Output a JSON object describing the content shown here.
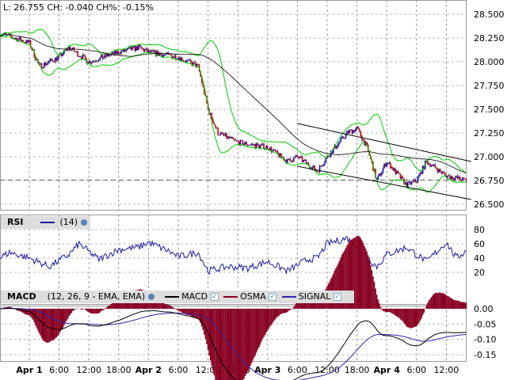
{
  "header": {
    "quote": "L: 26.755 CH: -0.040 CH%: -0.15%"
  },
  "rsi_legend": {
    "title": "RSI",
    "param": "(14)"
  },
  "macd_legend": {
    "title": "MACD",
    "param": "(12, 26, 9 - EMA, EMA)",
    "macd": "MACD",
    "osma": "OSMA",
    "signal": "SIGNAL"
  },
  "colors": {
    "up": "#0000cc",
    "down": "#cc0000",
    "bands": "#00cc00",
    "ma": "#000000",
    "rsi": "#1a1aa0",
    "osma": "#880022",
    "signal": "#3322aa"
  },
  "chart_data": [
    {
      "type": "candlestick",
      "title": "Price",
      "ylim": [
        26.4,
        28.62
      ],
      "yticks": [
        "28.500",
        "28.250",
        "28.000",
        "27.750",
        "27.500",
        "27.250",
        "27.000",
        "26.750",
        "26.500"
      ],
      "xticks": [
        "Apr 1",
        "6:00",
        "12:00",
        "18:00",
        "Apr 2",
        "6:00",
        "12:00",
        "18:00",
        "Apr 3",
        "6:00",
        "12:00",
        "18:00",
        "Apr 4",
        "6:00",
        "12:00"
      ],
      "last_price": 26.755,
      "price_keypoints_hour_value": [
        [
          -6,
          28.3
        ],
        [
          0,
          28.2
        ],
        [
          2,
          27.95
        ],
        [
          6,
          28.05
        ],
        [
          8,
          28.15
        ],
        [
          12,
          28.0
        ],
        [
          18,
          28.1
        ],
        [
          22,
          28.15
        ],
        [
          24,
          28.1
        ],
        [
          30,
          28.05
        ],
        [
          34,
          27.95
        ],
        [
          36,
          27.5
        ],
        [
          38,
          27.25
        ],
        [
          42,
          27.15
        ],
        [
          48,
          27.1
        ],
        [
          52,
          26.95
        ],
        [
          54,
          27.0
        ],
        [
          58,
          26.85
        ],
        [
          60,
          27.0
        ],
        [
          64,
          27.25
        ],
        [
          66,
          27.3
        ],
        [
          68,
          27.1
        ],
        [
          70,
          26.75
        ],
        [
          72,
          26.95
        ],
        [
          76,
          26.7
        ],
        [
          78,
          26.75
        ],
        [
          80,
          26.95
        ],
        [
          84,
          26.8
        ],
        [
          88,
          26.75
        ]
      ],
      "trendlines": [
        [
          [
            54,
            27.35
          ],
          [
            89,
            26.95
          ]
        ],
        [
          [
            54,
            26.9
          ],
          [
            89,
            26.55
          ]
        ]
      ]
    },
    {
      "type": "line",
      "title": "RSI (14)",
      "ylim": [
        0,
        100
      ],
      "yticks": [
        "80",
        "60",
        "40",
        "20"
      ],
      "rsi_keypoints_hour_value": [
        [
          -6,
          40
        ],
        [
          -4,
          48
        ],
        [
          0,
          40
        ],
        [
          4,
          28
        ],
        [
          8,
          45
        ],
        [
          10,
          60
        ],
        [
          14,
          38
        ],
        [
          18,
          52
        ],
        [
          22,
          55
        ],
        [
          24,
          62
        ],
        [
          28,
          50
        ],
        [
          30,
          42
        ],
        [
          34,
          48
        ],
        [
          36,
          22
        ],
        [
          40,
          28
        ],
        [
          44,
          26
        ],
        [
          48,
          35
        ],
        [
          52,
          22
        ],
        [
          56,
          38
        ],
        [
          58,
          40
        ],
        [
          60,
          60
        ],
        [
          64,
          68
        ],
        [
          68,
          42
        ],
        [
          70,
          28
        ],
        [
          72,
          45
        ],
        [
          76,
          55
        ],
        [
          80,
          35
        ],
        [
          84,
          62
        ],
        [
          86,
          40
        ],
        [
          88,
          50
        ]
      ]
    },
    {
      "type": "line",
      "title": "MACD (12, 26, 9)",
      "ylim": [
        -0.16,
        0.03
      ],
      "yticks": [
        "0.00",
        "-0.05",
        "-0.10",
        "-0.15"
      ],
      "series": [
        "MACD",
        "OSMA",
        "SIGNAL"
      ]
    }
  ]
}
